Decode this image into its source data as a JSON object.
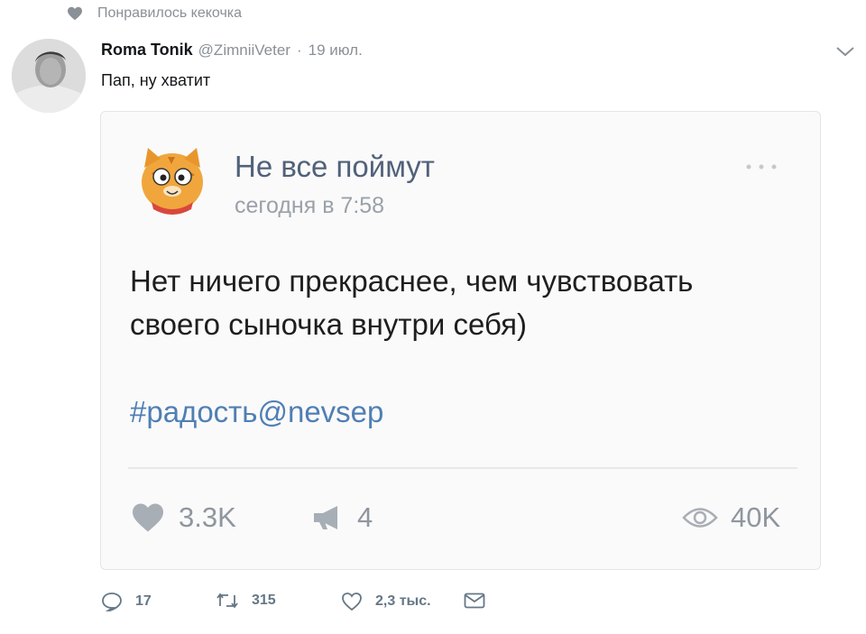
{
  "social_context": {
    "text": "Понравилось кекочка",
    "icon": "heart-icon"
  },
  "tweet": {
    "author_name": "Roma Tonik",
    "author_handle": "@ZimniiVeter",
    "separator": "·",
    "date": "19 июл.",
    "text": "Пап, ну хватит",
    "avatar": "user-avatar"
  },
  "embedded_post": {
    "community_name": "Не все поймут",
    "time": "сегодня в 7:58",
    "text_lines": [
      "Нет ничего прекраснее, чем чувствовать",
      "своего сыночка внутри себя)"
    ],
    "hashtag": "#радость@nevsep",
    "likes": "3.3K",
    "shares": "4",
    "views": "40K",
    "avatar": "cat-avatar"
  },
  "actions": {
    "reply_count": "17",
    "retweet_count": "315",
    "like_count": "2,3 тыс."
  },
  "colors": {
    "muted": "#8a9097",
    "link": "#4f7fb4",
    "community_name": "#51617a",
    "card_bg": "#fafafa"
  }
}
